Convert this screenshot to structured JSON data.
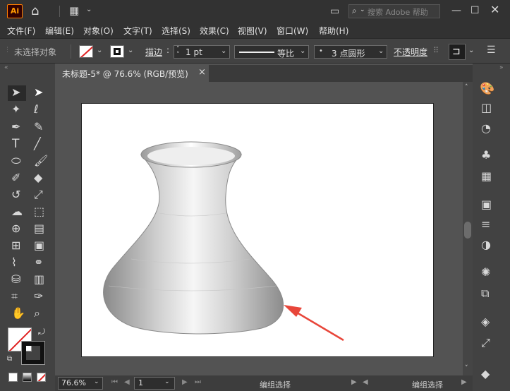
{
  "app": {
    "logo": "Ai"
  },
  "search": {
    "placeholder": "搜索 Adobe 帮助"
  },
  "menu": [
    "文件(F)",
    "编辑(E)",
    "对象(O)",
    "文字(T)",
    "选择(S)",
    "效果(C)",
    "视图(V)",
    "窗口(W)",
    "帮助(H)"
  ],
  "control": {
    "selection_status": "未选择对象",
    "stroke_label": "描边",
    "stroke_weight": "1 pt",
    "stroke_profile": "等比",
    "brush": "3 点圆形",
    "opacity_label": "不透明度"
  },
  "document": {
    "tab_title": "未标题-5* @ 76.6% (RGB/预览)",
    "close": "×"
  },
  "status": {
    "zoom": "76.6%",
    "artboard_number": "1",
    "tool_status_left": "编组选择",
    "tool_status_right": "编组选择"
  },
  "colors": {
    "arrow": "#e8463a",
    "panel": "#424242",
    "chrome": "#323232"
  }
}
